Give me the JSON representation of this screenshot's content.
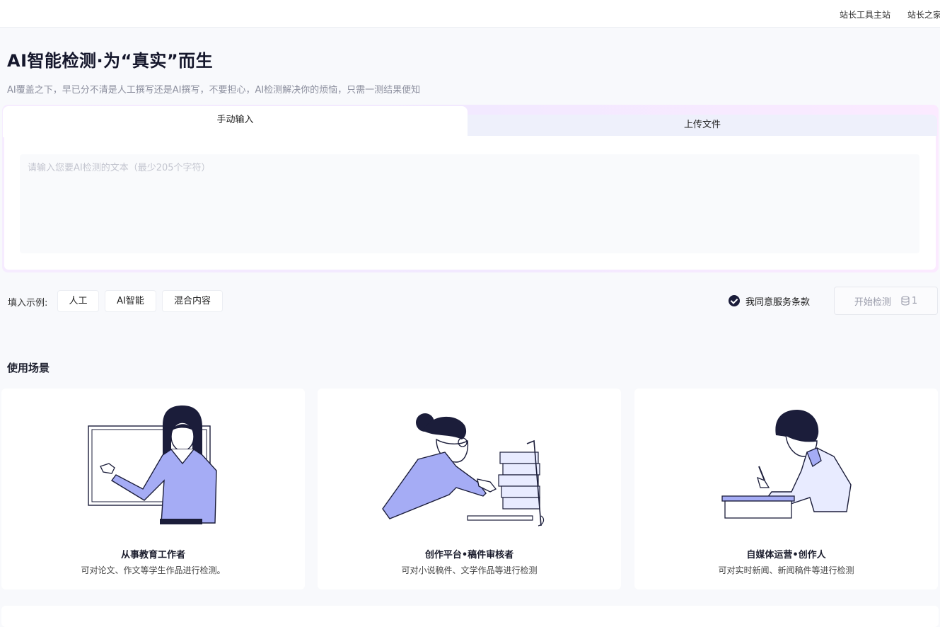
{
  "topbar": {
    "links": [
      "站长工具主站",
      "站长之家"
    ]
  },
  "header": {
    "title": "AI智能检测·为“真实”而生",
    "subtitle": "AI覆盖之下，早已分不清是人工撰写还是AI撰写，不要担心，AI检测解决你的烦恼，只需一测结果便知"
  },
  "tabs": [
    {
      "label": "手动输入",
      "active": true
    },
    {
      "label": "上传文件",
      "active": false
    }
  ],
  "input": {
    "placeholder": "请输入您要AI检测的文本（最少205个字符）",
    "value": ""
  },
  "examples": {
    "label": "填入示例:",
    "chips": [
      "人工",
      "AI智能",
      "混合内容"
    ]
  },
  "agree": {
    "checked": true,
    "label": "我同意服务条款"
  },
  "start": {
    "label": "开始检测",
    "count": "1",
    "icon": "database-icon"
  },
  "scenes": {
    "title": "使用场景",
    "items": [
      {
        "title": "从事教育工作者",
        "desc": "可对论文、作文等学生作品进行检测。",
        "icon": "teacher-illustration"
      },
      {
        "title": "创作平台•稿件审核者",
        "desc": "可对小说稿件、文学作品等进行检测",
        "icon": "reviewer-illustration"
      },
      {
        "title": "自媒体运营•创作人",
        "desc": "可对实时新闻、新闻稿件等进行检测",
        "icon": "writer-illustration"
      }
    ]
  },
  "colors": {
    "accent": "#a5acf5",
    "dark": "#1b1d3a",
    "background": "#f8f9fc"
  }
}
